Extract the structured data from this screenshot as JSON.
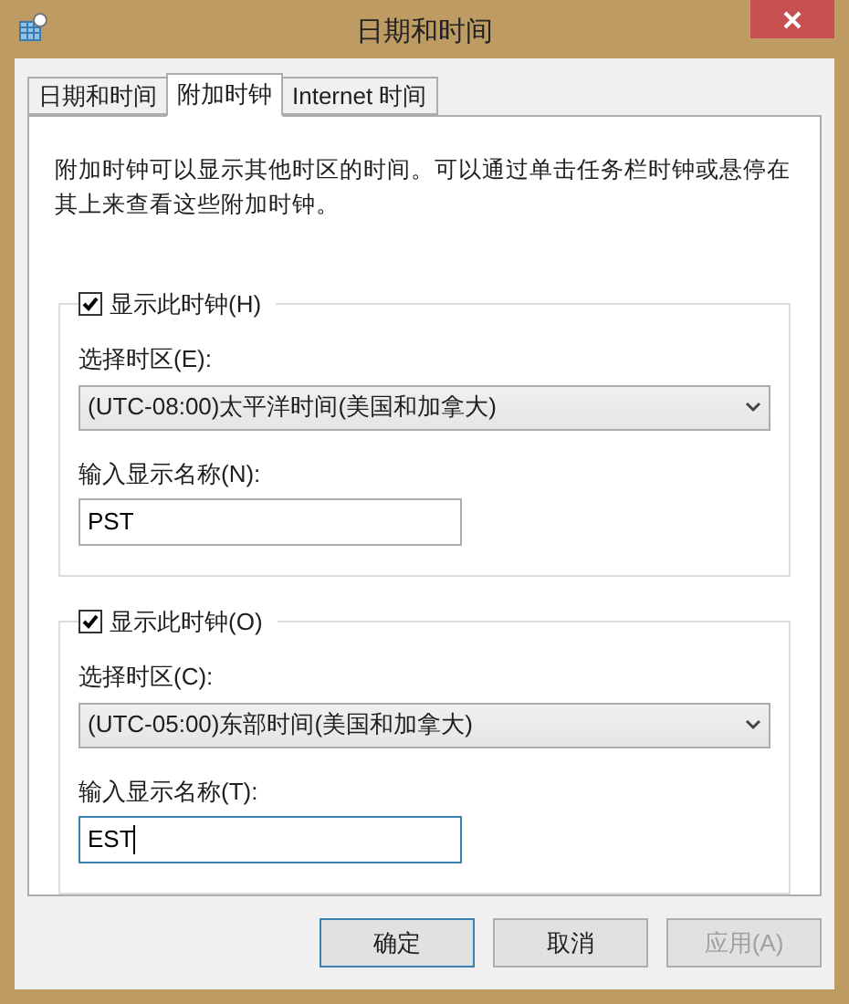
{
  "window": {
    "title": "日期和时间"
  },
  "tabs": [
    {
      "label": "日期和时间",
      "selected": false
    },
    {
      "label": "附加时钟",
      "selected": true
    },
    {
      "label": "Internet 时间",
      "selected": false
    }
  ],
  "description": "附加时钟可以显示其他时区的时间。可以通过单击任务栏时钟或悬停在其上来查看这些附加时钟。",
  "clocks": [
    {
      "show_label": "显示此时钟(H)",
      "checked": true,
      "zone_label": "选择时区(E):",
      "zone": "(UTC-08:00)太平洋时间(美国和加拿大)",
      "name_label": "输入显示名称(N):",
      "name": "PST",
      "focused": false
    },
    {
      "show_label": "显示此时钟(O)",
      "checked": true,
      "zone_label": "选择时区(C):",
      "zone": "(UTC-05:00)东部时间(美国和加拿大)",
      "name_label": "输入显示名称(T):",
      "name": "EST",
      "focused": true
    }
  ],
  "buttons": [
    {
      "label": "确定",
      "default": true,
      "disabled": false
    },
    {
      "label": "取消",
      "default": false,
      "disabled": false
    },
    {
      "label": "应用(A)",
      "default": false,
      "disabled": true
    }
  ]
}
